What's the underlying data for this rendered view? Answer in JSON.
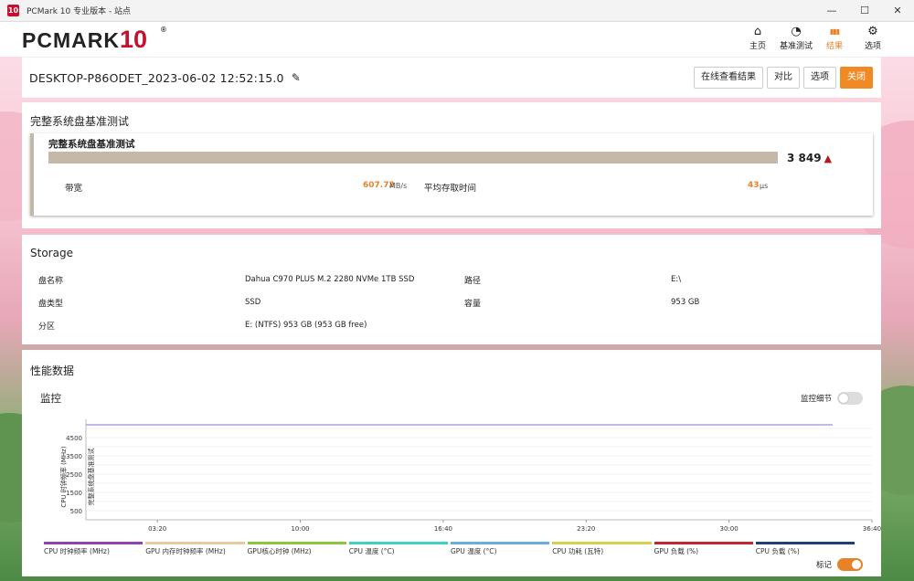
{
  "window": {
    "title": "PCMark 10 专业版本 - 站点",
    "icon_text": "10",
    "minimize": "—",
    "maximize": "☐",
    "close": "✕"
  },
  "logo": {
    "main": "PCMARK",
    "num": "10",
    "reg": "®"
  },
  "nav": [
    {
      "label": "主页",
      "icon": "home-icon",
      "glyph": "⌂"
    },
    {
      "label": "基准测试",
      "icon": "gauge-icon",
      "glyph": "◔"
    },
    {
      "label": "结果",
      "icon": "bar-chart-icon",
      "glyph": "▮▮▮"
    },
    {
      "label": "选项",
      "icon": "gear-icon",
      "glyph": "⚙"
    }
  ],
  "result": {
    "title": "DESKTOP-P86ODET_2023-06-02 12:52:15.0",
    "edit_glyph": "✎",
    "buttons": {
      "online": "在线查看结果",
      "compare": "对比",
      "options": "选项",
      "close": "关闭"
    }
  },
  "benchmark": {
    "section_title": "完整系统盘基准测试",
    "card_title": "完整系统盘基准测试",
    "score": "3 849",
    "warning_glyph": "▲",
    "bandwidth_label": "带宽",
    "bandwidth_value": "607.72",
    "bandwidth_unit": "MB/s",
    "access_label": "平均存取时间",
    "access_value": "43",
    "access_unit": "μs",
    "colors": {
      "bar": "#c4b8a8",
      "value": "#e8822a",
      "warning": "#b01c1c"
    }
  },
  "storage": {
    "title": "Storage",
    "rows": [
      {
        "k1": "盘名称",
        "v1": "Dahua C970 PLUS M.2 2280 NVMe 1TB SSD",
        "k2": "路径",
        "v2": "E:\\"
      },
      {
        "k1": "盘类型",
        "v1": "SSD",
        "k2": "容量",
        "v2": "953 GB"
      },
      {
        "k1": "分区",
        "v1": "E: (NTFS) 953 GB (953 GB free)",
        "k2": "",
        "v2": ""
      }
    ]
  },
  "perf": {
    "title": "性能数据",
    "monitor": "监控",
    "detail_toggle": "监控细节",
    "marker_toggle": "标记",
    "y_label_1": "CPU 时钟频率 (MHz)",
    "y_label_2": "完整系统盘基准测试",
    "legend": [
      {
        "label": "CPU 时钟频率 (MHz)",
        "color": "#8e44ad"
      },
      {
        "label": "GPU 内存时钟频率 (MHz)",
        "color": "#e8c9a0"
      },
      {
        "label": "GPU核心时钟 (MHz)",
        "color": "#8cc63f"
      },
      {
        "label": "CPU 温度 (°C)",
        "color": "#3ed1c1"
      },
      {
        "label": "GPU 温度 (°C)",
        "color": "#6aaee0"
      },
      {
        "label": "CPU 功耗 (瓦特)",
        "color": "#d7d04a"
      },
      {
        "label": "GPU 负载 (%)",
        "color": "#c0282e"
      },
      {
        "label": "CPU 负载 (%)",
        "color": "#1f3f7a"
      }
    ]
  },
  "chart_data": {
    "type": "line",
    "title": "",
    "xlabel": "",
    "ylabel": "CPU 时钟频率 (MHz)",
    "y_ticks": [
      500,
      1500,
      2500,
      3500,
      4500
    ],
    "x_ticks": [
      "03:20",
      "10:00",
      "16:40",
      "23:20",
      "30:00",
      "36:40"
    ],
    "ylim": [
      0,
      5500
    ],
    "xlim_seconds": [
      0,
      2200
    ],
    "series": [
      {
        "name": "CPU 时钟频率 (MHz)",
        "color": "#9c8fe0",
        "x": [
          0,
          2090
        ],
        "y": [
          5200,
          5200
        ]
      }
    ]
  }
}
